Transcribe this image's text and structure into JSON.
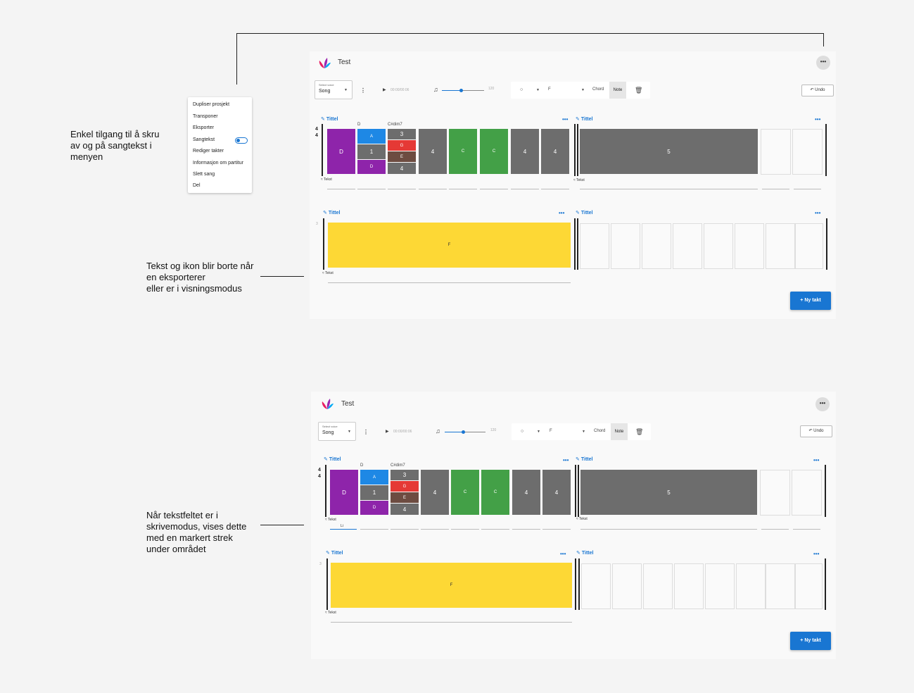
{
  "annotations": {
    "menu_note": "Enkel tilgang til å skru\nav og på sangtekst i\nmenyen",
    "export_note": "Tekst og ikon blir borte når\nen eksporterer\neller er i visningsmodus",
    "edit_note": "Når tekstfeltet er i\nskrivemodus, vises dette\nmed en markert strek\nunder området"
  },
  "menu": {
    "items": [
      "Dupliser prosjekt",
      "Transponer",
      "Eksporter",
      "Sangtekst",
      "Rediger takter",
      "Informasjon om partitur",
      "Slett sang",
      "Del"
    ]
  },
  "app": {
    "title": "Test",
    "more_label": "•••",
    "select_voice_label": "Select voice",
    "select_voice_value": "Song",
    "time_display": "00:00/00:06",
    "tempo_value": "120",
    "tempo_fraction": 0.45,
    "note_key": "F",
    "chord_label": "Chord",
    "note_label": "Note",
    "undo_label": "Undo",
    "new_bar_label": "Ny takt",
    "section_title": "Tittel",
    "text_label": "Tekst",
    "time_signature_top": "4",
    "time_signature_bottom": "4",
    "bar_number": "3",
    "chord_d": "D",
    "chord_cdim7": "C#dim7",
    "lyric_input": "Li",
    "section1_cells": {
      "d": "D",
      "a": "A",
      "one": "1",
      "d2": "D",
      "three": "3",
      "g": "G",
      "e": "E",
      "four_small": "4",
      "four1": "4",
      "c1": "C",
      "c2": "C",
      "four2": "4",
      "four3": "4"
    },
    "section2_cell": "5",
    "section3_cell": "F"
  },
  "colors": {
    "purple": "#8e24aa",
    "blue": "#1e88e5",
    "gray": "#6d6d6d",
    "red": "#e53935",
    "brown": "#6d4c41",
    "green": "#43a047",
    "yellow": "#fdd835",
    "accent": "#1976d2"
  }
}
